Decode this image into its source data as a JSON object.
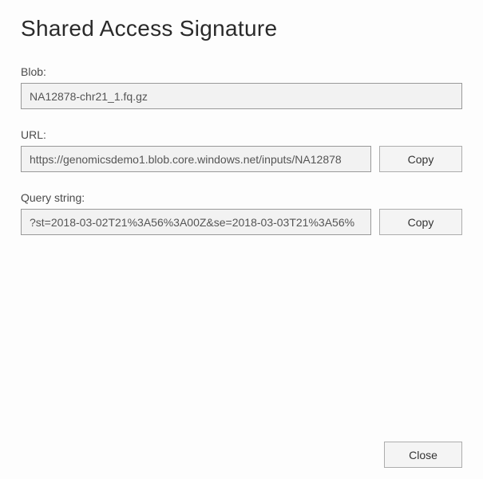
{
  "title": "Shared Access Signature",
  "fields": {
    "blob": {
      "label": "Blob:",
      "value": "NA12878-chr21_1.fq.gz"
    },
    "url": {
      "label": "URL:",
      "value": "https://genomicsdemo1.blob.core.windows.net/inputs/NA12878",
      "copy_label": "Copy"
    },
    "query": {
      "label": "Query string:",
      "value": "?st=2018-03-02T21%3A56%3A00Z&se=2018-03-03T21%3A56%",
      "copy_label": "Copy"
    }
  },
  "footer": {
    "close_label": "Close"
  }
}
